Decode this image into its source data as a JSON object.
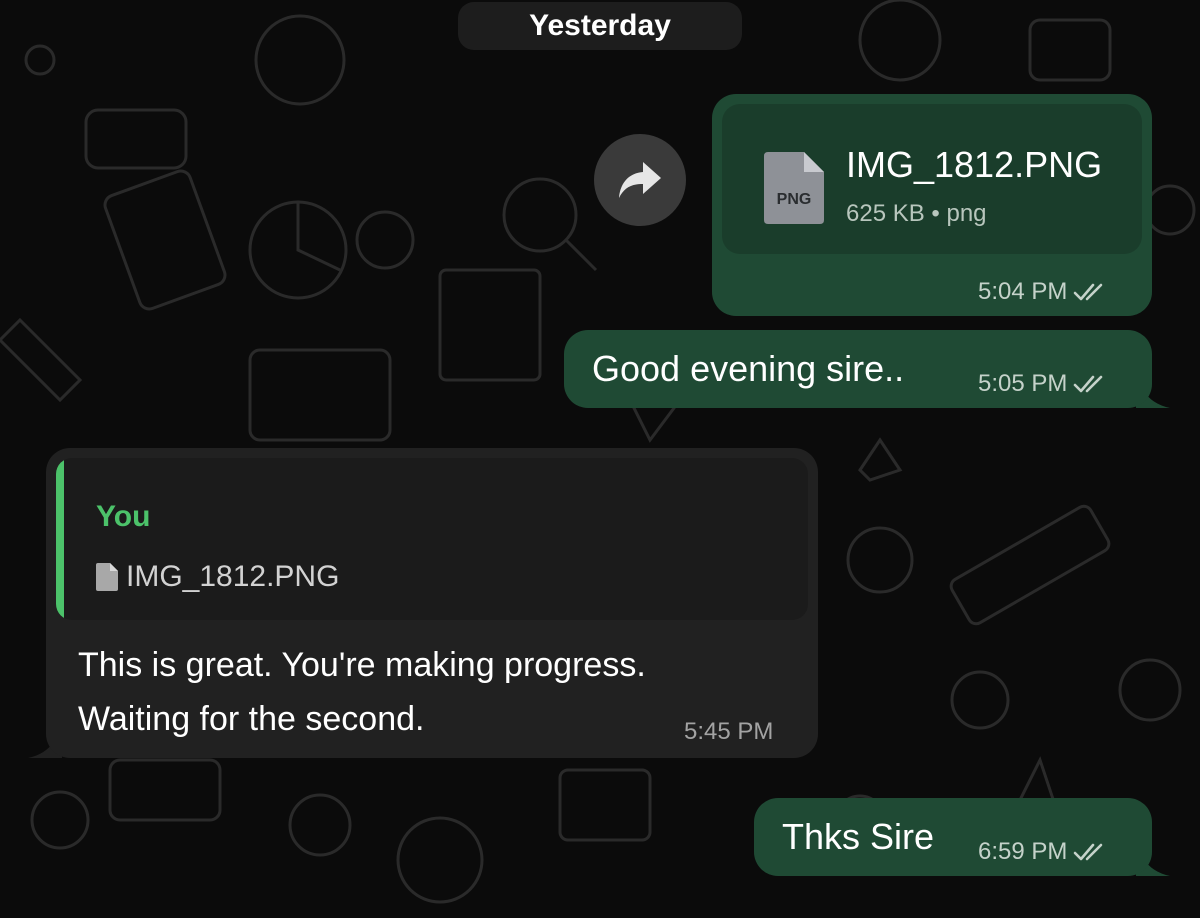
{
  "chat": {
    "date_separator": "Yesterday",
    "messages": [
      {
        "direction": "outgoing",
        "type": "document",
        "file_name": "IMG_1812.PNG",
        "file_badge": "PNG",
        "file_meta": "625 KB • png",
        "time": "5:04 PM",
        "status": "read"
      },
      {
        "direction": "outgoing",
        "type": "text",
        "text": "Good evening sire..",
        "time": "5:05 PM",
        "status": "read"
      },
      {
        "direction": "incoming",
        "type": "reply",
        "quote_author": "You",
        "quote_file": "IMG_1812.PNG",
        "text_line1": "This is great. You're making progress.",
        "text_line2": "Waiting for the second.",
        "time": "5:45 PM"
      },
      {
        "direction": "outgoing",
        "type": "text",
        "text": "Thks Sire",
        "time": "6:59 PM",
        "status": "read"
      }
    ]
  },
  "colors": {
    "background": "#0b0b0b",
    "outgoing_bubble": "#1f4a34",
    "incoming_bubble": "#212121",
    "quote_accent": "#4cc26a"
  },
  "icons": {
    "forward": "forward-arrow-icon",
    "document": "file-icon",
    "read_receipt": "double-check-icon"
  }
}
